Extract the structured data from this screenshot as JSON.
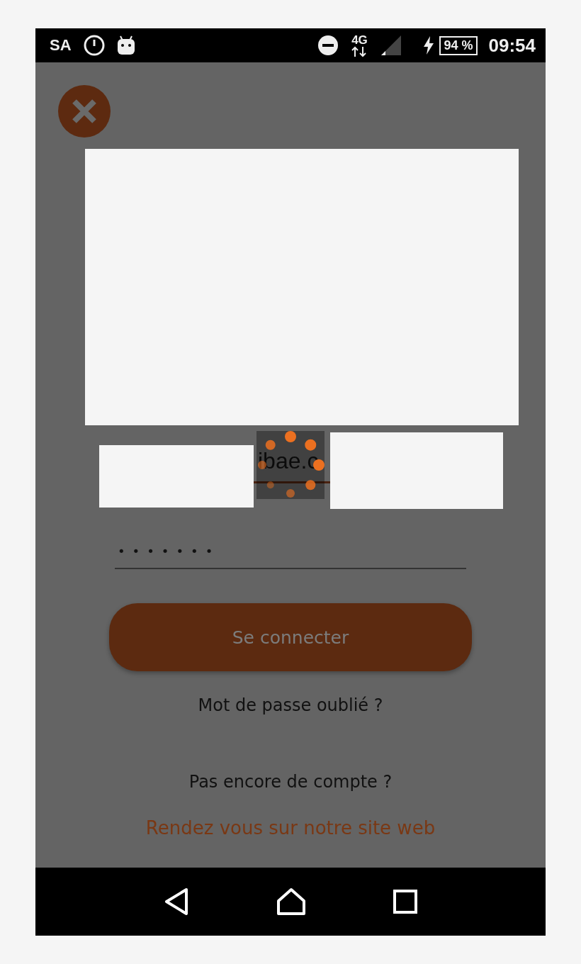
{
  "status_bar": {
    "carrier": "SA",
    "network": "4G",
    "battery": "94 %",
    "time": "09:54"
  },
  "login": {
    "partial_text": "ibae.c",
    "loading": true,
    "password": "•••••••",
    "connect_button": "Se connecter",
    "forgot_link": "Mot de passe oublié ?",
    "no_account": "Pas encore de compte ?",
    "website_link": "Rendez vous sur notre site web"
  }
}
